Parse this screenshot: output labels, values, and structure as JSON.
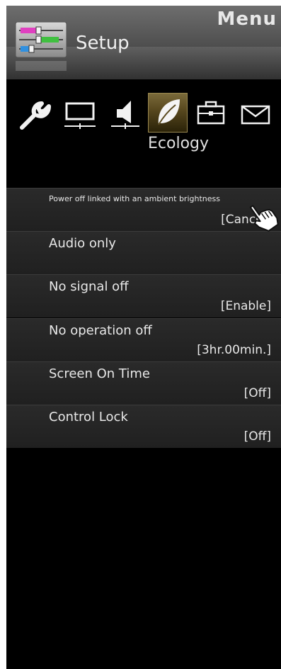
{
  "header": {
    "menu_title": "Menu",
    "section_title": "Setup"
  },
  "categories": {
    "icons": [
      "wrench-icon",
      "monitor-icon",
      "speaker-icon",
      "leaf-icon",
      "briefcase-icon",
      "mail-icon"
    ],
    "selected_label": "Ecology",
    "accent_color": "#7a6a3a"
  },
  "rows": [
    {
      "label": "Power off linked with an ambient brightness",
      "value": "[Cancel]"
    },
    {
      "label": "Audio only",
      "value": ""
    },
    {
      "label": "No signal off",
      "value": "[Enable]"
    },
    {
      "label": "No operation off",
      "value": "[3hr.00min.]"
    },
    {
      "label": "Screen On Time",
      "value": "[Off]"
    },
    {
      "label": "Control Lock",
      "value": "[Off]"
    }
  ]
}
